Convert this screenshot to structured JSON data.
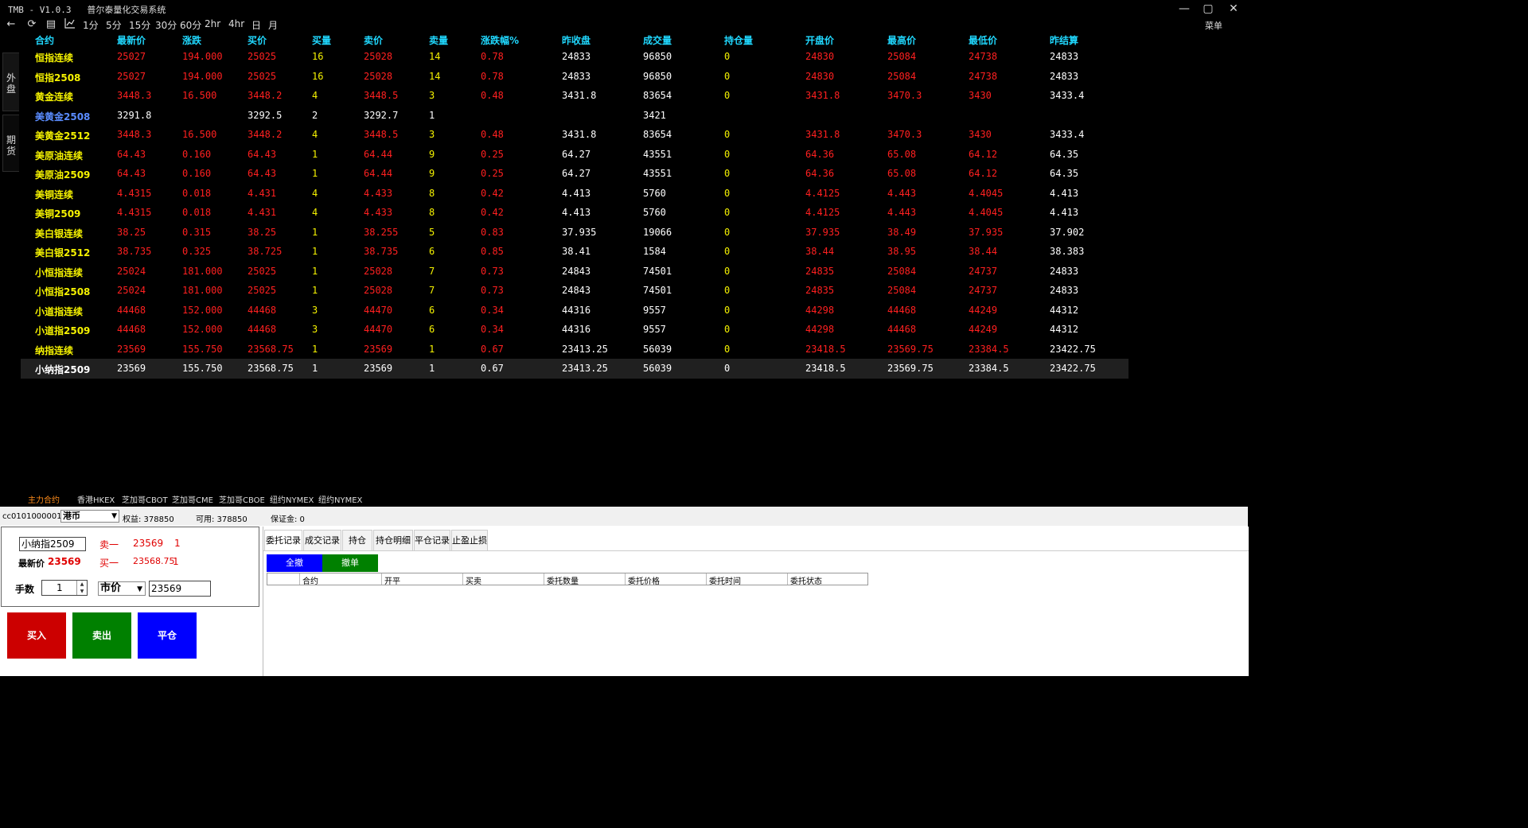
{
  "window": {
    "title": "TMB - V1.0.3   普尔泰量化交易系统",
    "min_label": "—",
    "max_label": "▢",
    "close_label": "✕"
  },
  "toolbar": {
    "periods": [
      "1分",
      "5分",
      "15分",
      "30分",
      "60分",
      "2hr",
      "4hr",
      "日",
      "月"
    ],
    "menu_label": "菜单"
  },
  "side_tabs": [
    "外盘",
    "期货"
  ],
  "quote_table": {
    "columns": [
      "合约",
      "最新价",
      "涨跌",
      "买价",
      "买量",
      "卖价",
      "卖量",
      "涨跌幅%",
      "昨收盘",
      "成交量",
      "持仓量",
      "开盘价",
      "最高价",
      "最低价",
      "昨结算"
    ],
    "rows": [
      [
        "恒指连续",
        "25027",
        "194.000",
        "25025",
        "16",
        "25028",
        "14",
        "0.78",
        "24833",
        "96850",
        "0",
        "24830",
        "25084",
        "24738",
        "24833"
      ],
      [
        "恒指2508",
        "25027",
        "194.000",
        "25025",
        "16",
        "25028",
        "14",
        "0.78",
        "24833",
        "96850",
        "0",
        "24830",
        "25084",
        "24738",
        "24833"
      ],
      [
        "黄金连续",
        "3448.3",
        "16.500",
        "3448.2",
        "4",
        "3448.5",
        "3",
        "0.48",
        "3431.8",
        "83654",
        "0",
        "3431.8",
        "3470.3",
        "3430",
        "3433.4"
      ],
      [
        "美黄金2508",
        "3291.8",
        "",
        "3292.5",
        "2",
        "3292.7",
        "1",
        "",
        "",
        "3421",
        "",
        "",
        "",
        "",
        ""
      ],
      [
        "美黄金2512",
        "3448.3",
        "16.500",
        "3448.2",
        "4",
        "3448.5",
        "3",
        "0.48",
        "3431.8",
        "83654",
        "0",
        "3431.8",
        "3470.3",
        "3430",
        "3433.4"
      ],
      [
        "美原油连续",
        "64.43",
        "0.160",
        "64.43",
        "1",
        "64.44",
        "9",
        "0.25",
        "64.27",
        "43551",
        "0",
        "64.36",
        "65.08",
        "64.12",
        "64.35"
      ],
      [
        "美原油2509",
        "64.43",
        "0.160",
        "64.43",
        "1",
        "64.44",
        "9",
        "0.25",
        "64.27",
        "43551",
        "0",
        "64.36",
        "65.08",
        "64.12",
        "64.35"
      ],
      [
        "美铜连续",
        "4.4315",
        "0.018",
        "4.431",
        "4",
        "4.433",
        "8",
        "0.42",
        "4.413",
        "5760",
        "0",
        "4.4125",
        "4.443",
        "4.4045",
        "4.413"
      ],
      [
        "美铜2509",
        "4.4315",
        "0.018",
        "4.431",
        "4",
        "4.433",
        "8",
        "0.42",
        "4.413",
        "5760",
        "0",
        "4.4125",
        "4.443",
        "4.4045",
        "4.413"
      ],
      [
        "美白银连续",
        "38.25",
        "0.315",
        "38.25",
        "1",
        "38.255",
        "5",
        "0.83",
        "37.935",
        "19066",
        "0",
        "37.935",
        "38.49",
        "37.935",
        "37.902"
      ],
      [
        "美白银2512",
        "38.735",
        "0.325",
        "38.725",
        "1",
        "38.735",
        "6",
        "0.85",
        "38.41",
        "1584",
        "0",
        "38.44",
        "38.95",
        "38.44",
        "38.383"
      ],
      [
        "小恒指连续",
        "25024",
        "181.000",
        "25025",
        "1",
        "25028",
        "7",
        "0.73",
        "24843",
        "74501",
        "0",
        "24835",
        "25084",
        "24737",
        "24833"
      ],
      [
        "小恒指2508",
        "25024",
        "181.000",
        "25025",
        "1",
        "25028",
        "7",
        "0.73",
        "24843",
        "74501",
        "0",
        "24835",
        "25084",
        "24737",
        "24833"
      ],
      [
        "小道指连续",
        "44468",
        "152.000",
        "44468",
        "3",
        "44470",
        "6",
        "0.34",
        "44316",
        "9557",
        "0",
        "44298",
        "44468",
        "44249",
        "44312"
      ],
      [
        "小道指2509",
        "44468",
        "152.000",
        "44468",
        "3",
        "44470",
        "6",
        "0.34",
        "44316",
        "9557",
        "0",
        "44298",
        "44468",
        "44249",
        "44312"
      ],
      [
        "纳指连续",
        "23569",
        "155.750",
        "23568.75",
        "1",
        "23569",
        "1",
        "0.67",
        "23413.25",
        "56039",
        "0",
        "23418.5",
        "23569.75",
        "23384.5",
        "23422.75"
      ],
      [
        "小纳指2509",
        "23569",
        "155.750",
        "23568.75",
        "1",
        "23569",
        "1",
        "0.67",
        "23413.25",
        "56039",
        "0",
        "23418.5",
        "23569.75",
        "23384.5",
        "23422.75"
      ]
    ],
    "highlight_row": "美黄金2508",
    "selected_row": "小纳指2509"
  },
  "exchange_tabs": [
    "主力合约",
    "香港HKEX",
    "芝加哥CBOT",
    "芝加哥CME",
    "芝加哥CBOE",
    "纽约NYMEX",
    "纽约NYMEX"
  ],
  "account_bar": {
    "account_id": "cc0101000001",
    "currency": "港币",
    "equity": "权益: 378850",
    "available": "可用: 378850",
    "margin": "保证金: 0"
  },
  "order_panel": {
    "symbol": "小纳指2509",
    "last_label": "最新价",
    "last_price": "23569",
    "ask_label": "卖一",
    "ask_price": "23569",
    "ask_qty": "1",
    "bid_label": "买一",
    "bid_price": "23568.75",
    "bid_qty": "1",
    "qty_label": "手数",
    "qty_value": "1",
    "price_type": "市价",
    "price_value": "23569",
    "buy_label": "买入",
    "sell_label": "卖出",
    "close_label": "平仓"
  },
  "records_panel": {
    "tabs": [
      "委托记录",
      "成交记录",
      "持仓",
      "持仓明细",
      "平仓记录",
      "止盈止损"
    ],
    "cancel_all_label": "全撤",
    "cancel_label": "撤单",
    "columns": [
      "合约",
      "开平",
      "买卖",
      "委托数量",
      "委托价格",
      "委托时间",
      "委托状态"
    ]
  },
  "colors": {
    "name": "#f5f200",
    "rise": "#ff2020",
    "neutral": "#ffffff",
    "header": "#20d8ff",
    "highlight_name": "#5a8cff",
    "buy_button": "#cc0000",
    "sell_button": "#008000",
    "close_button": "#0000ff"
  }
}
